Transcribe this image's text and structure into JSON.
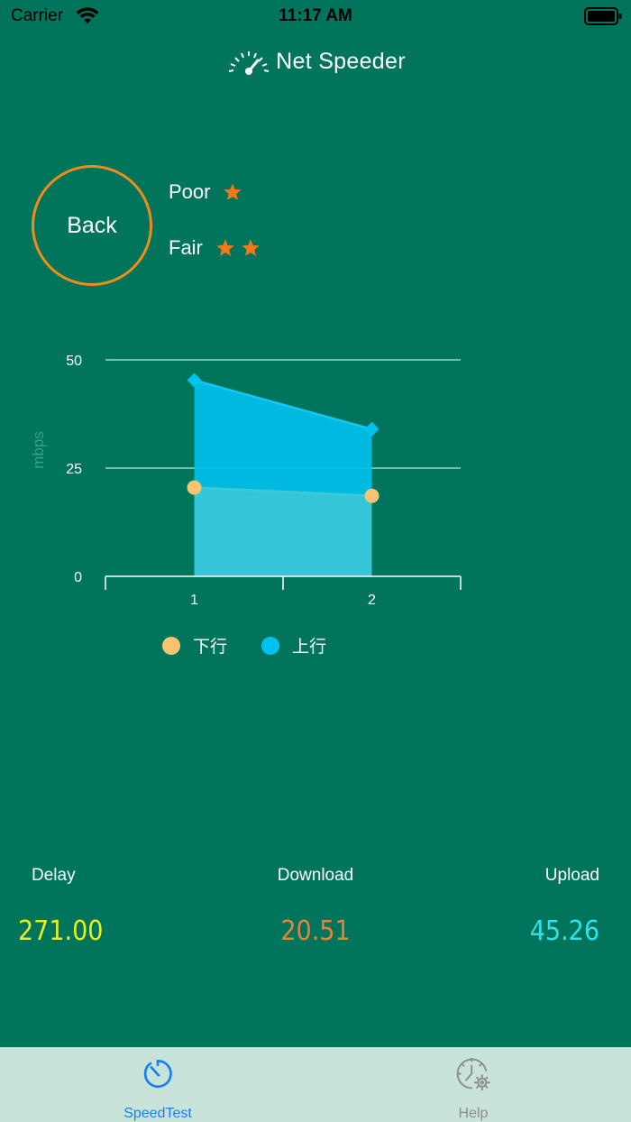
{
  "status_bar": {
    "carrier": "Carrier",
    "time": "11:17 AM"
  },
  "header": {
    "title": "Net Speeder",
    "icon": "speedometer-icon"
  },
  "back_button": {
    "label": "Back",
    "color": "#f08c1c"
  },
  "ratings": [
    {
      "label": "Poor",
      "stars": 1
    },
    {
      "label": "Fair",
      "stars": 2
    }
  ],
  "colors": {
    "background": "#00755c",
    "download": "#f8c471",
    "upload": "#00c2f0",
    "star": "#f07a1a",
    "tab_active": "#1a7ff0",
    "tab_inactive": "#8e8e8e",
    "tab_bar": "#c8e3d9"
  },
  "chart_data": {
    "type": "area",
    "ylabel": "mbps",
    "ylim": [
      0,
      50
    ],
    "yticks": [
      "0",
      "25",
      "50"
    ],
    "categories": [
      "1",
      "2"
    ],
    "grid": true,
    "legend": "bottom",
    "series": [
      {
        "name": "下行",
        "values": [
          20.5,
          18.6
        ],
        "marker": "circle"
      },
      {
        "name": "上行",
        "values": [
          45.3,
          34.0
        ],
        "marker": "diamond"
      }
    ]
  },
  "stats": {
    "delay": {
      "label": "Delay",
      "value": "271.00",
      "color": "#e6f021"
    },
    "download": {
      "label": "Download",
      "value": "20.51",
      "color": "#e8823a"
    },
    "upload": {
      "label": "Upload",
      "value": "45.26",
      "color": "#33e0e8"
    }
  },
  "tabs": [
    {
      "label": "SpeedTest",
      "icon": "stopwatch-icon",
      "active": true
    },
    {
      "label": "Help",
      "icon": "clock-gear-icon",
      "active": false
    }
  ]
}
